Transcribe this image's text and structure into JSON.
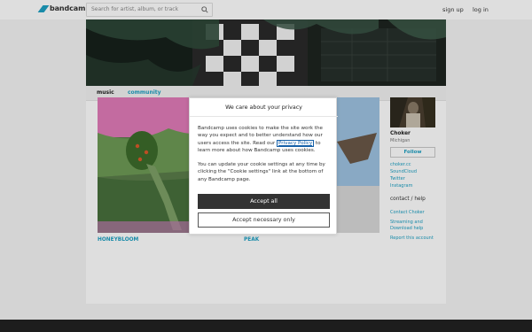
{
  "header": {
    "logo_text": "bandcamp",
    "search_placeholder": "Search for artist, album, or track",
    "signup": "sign up",
    "login": "log in"
  },
  "tabs": {
    "music": "music",
    "community": "community"
  },
  "albums": [
    {
      "title": "HONEYBLOOM"
    },
    {
      "title": "PEAK"
    }
  ],
  "sidebar": {
    "band_name": "Choker",
    "location": "Michigan",
    "follow": "Follow",
    "links": [
      "choker.cc",
      "SoundCloud",
      "Twitter",
      "Instagram"
    ],
    "contact_heading": "contact / help",
    "help_links": [
      "Contact Choker",
      "Streaming and",
      "Download help",
      "Report this account"
    ]
  },
  "privacy_modal": {
    "title": "We care about your privacy",
    "paragraph1_part1": "Bandcamp uses cookies to make the site work the way you expect and to better understand how our users access the site. Read our ",
    "privacy_link": "Privacy Policy",
    "paragraph1_part2": " to learn more about how Bandcamp uses cookies.",
    "paragraph2": "You can update your cookie settings at any time by clicking the \"Cookie settings\" link at the bottom of any Bandcamp page.",
    "accept_all": "Accept all",
    "accept_necessary": "Accept necessary only"
  },
  "colors": {
    "accent": "#1da0c3",
    "button_dark": "#333333",
    "footer": "#222222"
  }
}
